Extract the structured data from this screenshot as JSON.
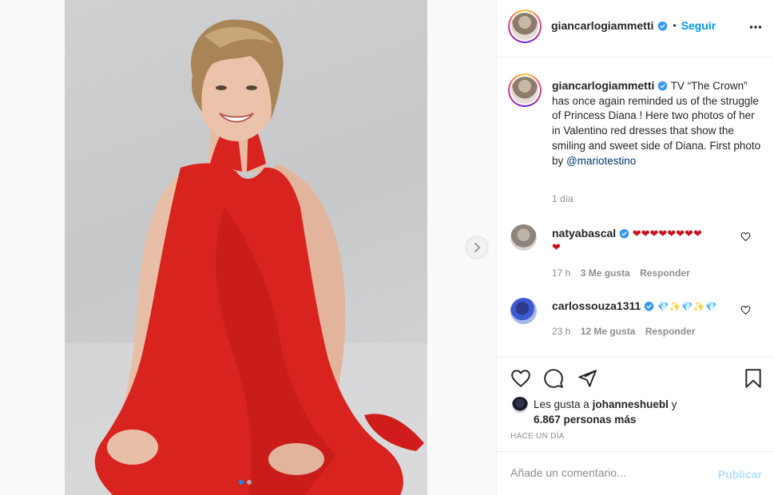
{
  "post": {
    "author": "giancarlogiammetti",
    "follow_label": "Seguir",
    "follow_separator": "•",
    "caption_author": "giancarlogiammetti",
    "caption_text": "TV “The Crown” has once again reminded us of the struggle of Princess Diana ! Here two photos of her in Valentino red dresses that show the smiling and sweet side of Diana. First photo by",
    "caption_mention": "@mariotestino",
    "caption_time": "1 día",
    "carousel_count": 2,
    "carousel_index": 0
  },
  "comments": [
    {
      "user": "natyabascal",
      "text_line1": "❤❤❤❤❤❤❤❤",
      "text_line2": "❤",
      "time": "17 h",
      "likes": "3 Me gusta",
      "reply": "Responder"
    },
    {
      "user": "carlossouza1311",
      "text_line1": "💎✨💎✨💎",
      "time": "23 h",
      "likes": "12 Me gusta",
      "reply": "Responder"
    }
  ],
  "engagement": {
    "likes_prefix": "Les gusta a",
    "liked_by": "johanneshuebl",
    "likes_conj": "y",
    "others": "6.867 personas más",
    "posted": "HACE UN DÍA"
  },
  "composer": {
    "placeholder": "Añade un comentario...",
    "publish_label": "Publicar"
  },
  "colors": {
    "accent": "#0095f6",
    "dress_red": "#d8231f",
    "verified": "#3897f0"
  },
  "icons": {
    "verified": "verified-badge-icon",
    "more": "more-options-icon",
    "like": "heart-icon",
    "comment": "comment-icon",
    "share": "paper-plane-icon",
    "save": "bookmark-icon",
    "next": "chevron-right-icon"
  }
}
